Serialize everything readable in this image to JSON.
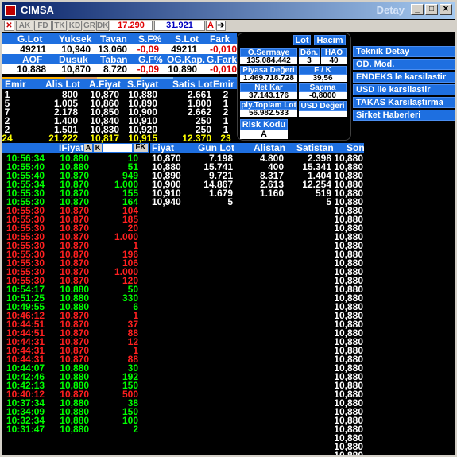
{
  "window": {
    "title": "CIMSA",
    "detay": "Detay",
    "min": "_",
    "max": "□",
    "close": "✕"
  },
  "toolbar": {
    "items": [
      "AK",
      "FD",
      "TK",
      "KD",
      "GR",
      "DK"
    ],
    "price1": "17.290",
    "price2": "31.921",
    "a_label": "A"
  },
  "summary": {
    "headers": [
      "G.Lot",
      "Yuksek",
      "Tavan",
      "S.F%",
      "S.Lot",
      "Fark"
    ],
    "values": [
      "49211",
      "10,940",
      "13,060",
      "-0,09",
      "49211",
      "-0,010"
    ],
    "headers2": [
      "AOF",
      "Dusuk",
      "Taban",
      "G.F%",
      "OG.Kap.",
      "G.Fark"
    ],
    "values2": [
      "10,888",
      "10,870",
      "8,720",
      "-0,09",
      "10,890",
      "-0,010"
    ]
  },
  "depth": {
    "headers": [
      "Emir",
      "Alis Lot",
      "A.Fiyat",
      "S.Fiyat",
      "Satis Lot",
      "Emir"
    ],
    "rows": [
      [
        "1",
        "800",
        "10,870",
        "10,880",
        "2.661",
        "2"
      ],
      [
        "5",
        "1.005",
        "10,860",
        "10,890",
        "1.800",
        "1"
      ],
      [
        "7",
        "2.178",
        "10,850",
        "10,900",
        "2.662",
        "2"
      ],
      [
        "2",
        "1.400",
        "10,840",
        "10,910",
        "250",
        "1"
      ],
      [
        "2",
        "1.501",
        "10,830",
        "10,920",
        "250",
        "1"
      ]
    ],
    "totals": [
      "24",
      "21.222",
      "10,817",
      "10,915",
      "12.370",
      "23"
    ]
  },
  "fundamentals": {
    "lot_btn": "Lot",
    "hacim_btn": "Hacim",
    "sermaye_label": "Ö.Sermaye",
    "sermaye_value": "135.084.442",
    "don_label": "Dön.",
    "don_value": "3",
    "hao_label": "HAO",
    "hao_value": "40",
    "piyasa_label": "Piyasa Değeri",
    "piyasa_value": "1.469.718.728",
    "fk_label": "F / K",
    "fk_value": "39,56",
    "netkar_label": "Net Kar",
    "netkar_value": "37.143.176",
    "sapma_label": "Sapma",
    "sapma_value": "-0,8000",
    "toplamlot_label": "ply.Toplam Lot",
    "toplamlot_value": "56.982.533",
    "usd_label": "USD Değeri",
    "risk_label": "Risk Kodu",
    "risk_value": "A"
  },
  "links": [
    "Teknik Detay",
    "OD. Mod.",
    "ENDEKS le karsilastir",
    "USD ile karsilastir",
    "TAKAS Karsılaştırma",
    "Sirket Haberleri"
  ],
  "trades": {
    "headers": [
      "IFiyat",
      "A",
      "K",
      "",
      "FK"
    ],
    "rows": [
      [
        "10:56:34",
        "10,880",
        "10",
        "g"
      ],
      [
        "10:55:40",
        "10,880",
        "51",
        "g"
      ],
      [
        "10:55:40",
        "10,870",
        "949",
        "g"
      ],
      [
        "10:55:34",
        "10,870",
        "1.000",
        "g"
      ],
      [
        "10:55:30",
        "10,870",
        "155",
        "g"
      ],
      [
        "10:55:30",
        "10,870",
        "164",
        "g"
      ],
      [
        "10:55:30",
        "10,870",
        "104",
        "r"
      ],
      [
        "10:55:30",
        "10,870",
        "185",
        "r"
      ],
      [
        "10:55:30",
        "10,870",
        "20",
        "r"
      ],
      [
        "10:55:30",
        "10,870",
        "1.000",
        "r"
      ],
      [
        "10:55:30",
        "10,870",
        "1",
        "r"
      ],
      [
        "10:55:30",
        "10,870",
        "196",
        "r"
      ],
      [
        "10:55:30",
        "10,870",
        "106",
        "r"
      ],
      [
        "10:55:30",
        "10,870",
        "1.000",
        "r"
      ],
      [
        "10:55:30",
        "10,870",
        "120",
        "r"
      ],
      [
        "10:54:17",
        "10,880",
        "50",
        "g"
      ],
      [
        "10:51:25",
        "10,880",
        "330",
        "g"
      ],
      [
        "10:49:55",
        "10,880",
        "6",
        "g"
      ],
      [
        "10:46:12",
        "10,870",
        "1",
        "r"
      ],
      [
        "10:44:51",
        "10,870",
        "37",
        "r"
      ],
      [
        "10:44:51",
        "10,870",
        "88",
        "r"
      ],
      [
        "10:44:31",
        "10,870",
        "12",
        "r"
      ],
      [
        "10:44:31",
        "10,870",
        "1",
        "r"
      ],
      [
        "10:44:31",
        "10,870",
        "88",
        "r"
      ],
      [
        "10:44:07",
        "10,880",
        "30",
        "g"
      ],
      [
        "10:42:46",
        "10,880",
        "192",
        "g"
      ],
      [
        "10:42:13",
        "10,880",
        "150",
        "g"
      ],
      [
        "10:40:12",
        "10,870",
        "500",
        "r"
      ],
      [
        "10:37:34",
        "10,880",
        "38",
        "g"
      ],
      [
        "10:34:09",
        "10,880",
        "150",
        "g"
      ],
      [
        "10:32:34",
        "10,880",
        "100",
        "g"
      ],
      [
        "10:31:47",
        "10,880",
        "2",
        "g"
      ]
    ]
  },
  "distribution": {
    "headers": [
      "Fiyat",
      "Gun Lot",
      "Alistan",
      "Satistan",
      "Son"
    ],
    "rows": [
      [
        "10,870",
        "7.198",
        "4.800",
        "2.398",
        "10,880"
      ],
      [
        "10,880",
        "15.741",
        "400",
        "15.341",
        "10,880"
      ],
      [
        "10,890",
        "9.721",
        "8.317",
        "1.404",
        "10,880"
      ],
      [
        "10,900",
        "14.867",
        "2.613",
        "12.254",
        "10,880"
      ],
      [
        "10,910",
        "1.679",
        "1.160",
        "519",
        "10,880"
      ],
      [
        "10,940",
        "5",
        "",
        "5",
        "10,880"
      ]
    ],
    "son_extra": [
      "10,880",
      "10,880",
      "10,880",
      "10,880",
      "10,880",
      "10,880",
      "10,880",
      "10,880",
      "10,880",
      "10,880",
      "10,880",
      "10,880",
      "10,880",
      "10,880",
      "10,880",
      "10,880",
      "10,880",
      "10,880",
      "10,880",
      "10,880",
      "10,880",
      "10,880",
      "10,880",
      "10,880",
      "10,880",
      "10,880",
      "10,880",
      "10,880",
      "10,880",
      "10,880"
    ]
  },
  "colors": {
    "header_blue": "#1e6fe0",
    "up": "#00ff00",
    "down": "#ff2020",
    "negative": "#e00000"
  }
}
